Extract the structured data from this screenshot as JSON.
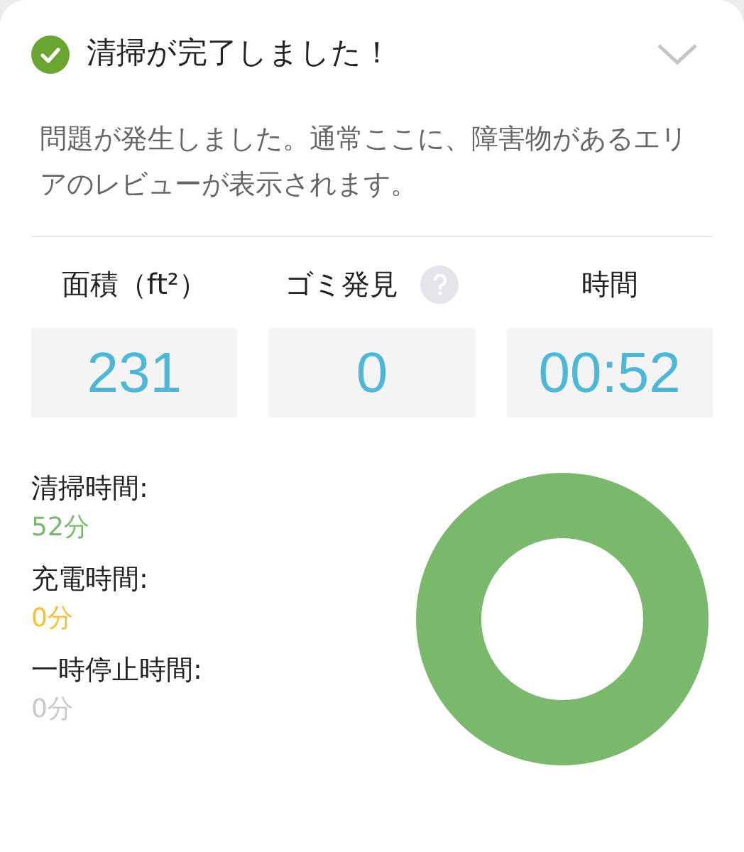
{
  "header": {
    "title": "清掃が完了しました！",
    "expanded": true
  },
  "description": "問題が発生しました。通常ここに、障害物があるエリアのレビューが表示されます。",
  "metrics": [
    {
      "label": "面積（ft²）",
      "value": "231",
      "kind": "plain"
    },
    {
      "label": "ゴミ発見",
      "value": "0",
      "kind": "with_help"
    },
    {
      "label": "時間",
      "value": "00:52",
      "kind": "plain"
    }
  ],
  "durations": [
    {
      "label": "清掃時間:",
      "value": "52分",
      "color": "#7ab86b"
    },
    {
      "label": "充電時間:",
      "value": "0分",
      "color": "#f5c22e"
    },
    {
      "label": "一時停止時間:",
      "value": "0分",
      "color": "#c8c8c8"
    }
  ]
}
